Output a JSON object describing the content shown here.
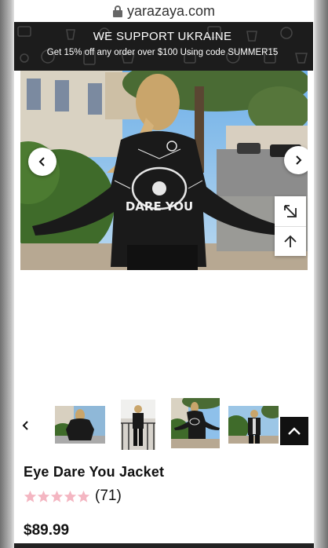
{
  "browser": {
    "url": "yarazaya.com",
    "lock_icon": "lock-icon"
  },
  "banner": {
    "title": "WE SUPPORT UKRAINE",
    "subtitle": "Get 15% off any order over $100 Using code SUMMER15",
    "background_color": "#1c1c1c"
  },
  "gallery": {
    "prev_icon": "chevron-left-icon",
    "next_icon": "chevron-right-icon",
    "expand_icon": "expand-icon",
    "up_icon": "arrow-up-icon",
    "jacket_print": "DARE YOU",
    "thumbnail_count": 4
  },
  "product": {
    "title": "Eye Dare You Jacket",
    "rating": 5,
    "rating_color": "#f4b6c2",
    "review_count": "(71)",
    "price": "$89.99"
  }
}
